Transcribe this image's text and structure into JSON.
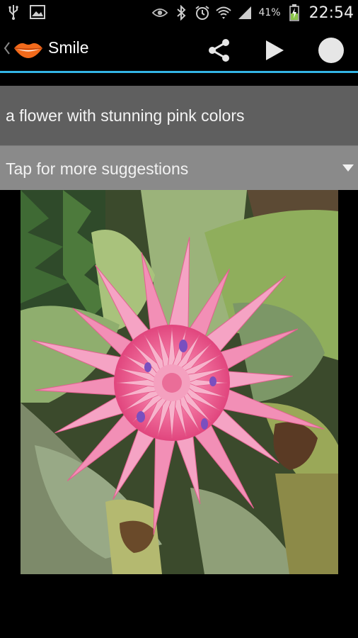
{
  "status_bar": {
    "icons": [
      "usb-icon",
      "image-icon",
      "eye-icon",
      "bluetooth-icon",
      "alarm-icon",
      "wifi-icon",
      "signal-icon",
      "battery-charging-icon"
    ],
    "battery_percent": "41%",
    "time": "22:54"
  },
  "action_bar": {
    "app_title": "Smile",
    "actions": [
      "share-icon",
      "play-icon",
      "record-icon"
    ],
    "accent_color": "#33b5e5"
  },
  "caption": {
    "text": "a flower with stunning pink colors"
  },
  "suggestions": {
    "label": "Tap for more suggestions"
  },
  "photo": {
    "subject": "pink-bromeliad-flower"
  }
}
